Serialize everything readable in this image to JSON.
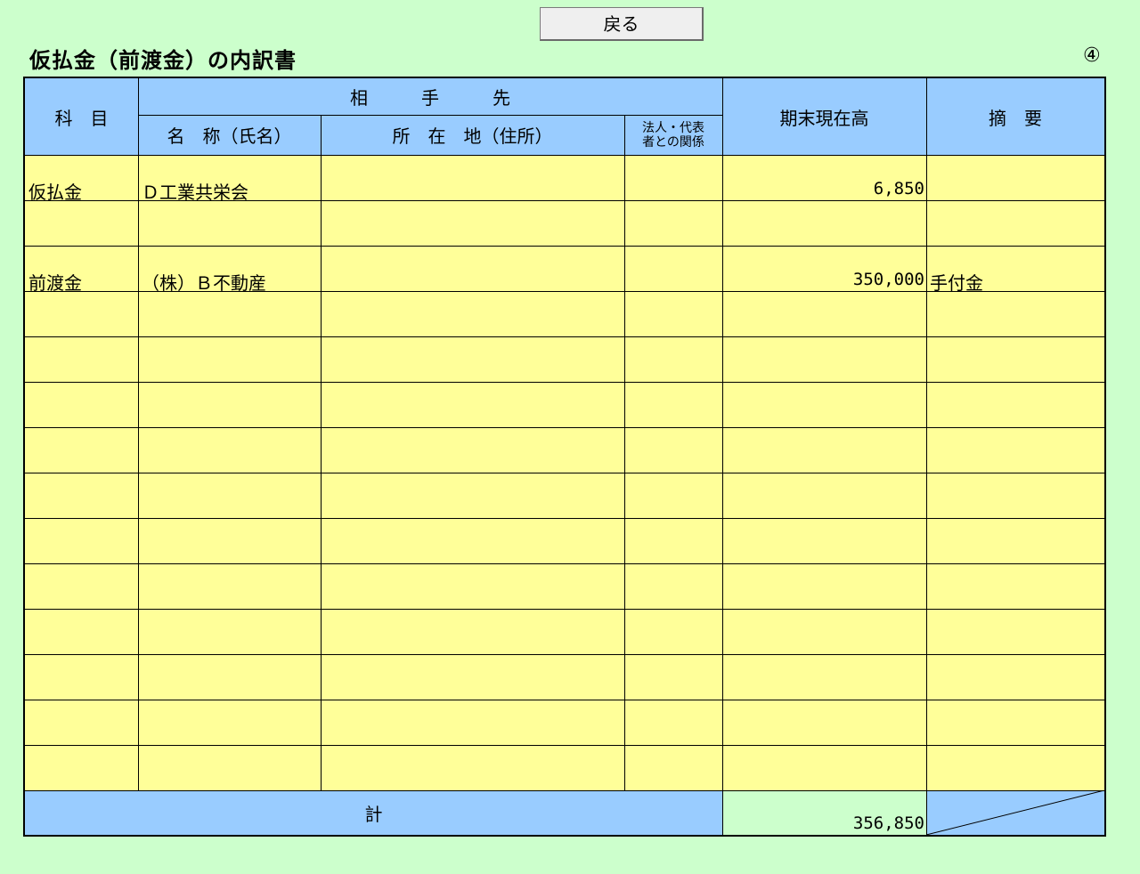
{
  "toolbar": {
    "back_label": "戻る"
  },
  "page": {
    "title": "仮払金（前渡金）の内訳書",
    "page_mark": "④"
  },
  "table": {
    "headers": {
      "subject": "科　目",
      "counterparty": "相　　　手　　　先",
      "name": "名　称（氏名）",
      "address": "所　在　地（住所）",
      "relation_line1": "法人・代表",
      "relation_line2": "者との関係",
      "balance": "期末現在高",
      "remarks": "摘　要"
    },
    "rows": [
      {
        "subject": "仮払金",
        "name": "Ｄ工業共栄会",
        "address": "",
        "relation": "",
        "balance": "6,850",
        "remarks": ""
      },
      {
        "subject": "",
        "name": "",
        "address": "",
        "relation": "",
        "balance": "",
        "remarks": ""
      },
      {
        "subject": "前渡金",
        "name": "（株）Ｂ不動産",
        "address": "",
        "relation": "",
        "balance": "350,000",
        "remarks": "手付金"
      },
      {
        "subject": "",
        "name": "",
        "address": "",
        "relation": "",
        "balance": "",
        "remarks": ""
      },
      {
        "subject": "",
        "name": "",
        "address": "",
        "relation": "",
        "balance": "",
        "remarks": ""
      },
      {
        "subject": "",
        "name": "",
        "address": "",
        "relation": "",
        "balance": "",
        "remarks": ""
      },
      {
        "subject": "",
        "name": "",
        "address": "",
        "relation": "",
        "balance": "",
        "remarks": ""
      },
      {
        "subject": "",
        "name": "",
        "address": "",
        "relation": "",
        "balance": "",
        "remarks": ""
      },
      {
        "subject": "",
        "name": "",
        "address": "",
        "relation": "",
        "balance": "",
        "remarks": ""
      },
      {
        "subject": "",
        "name": "",
        "address": "",
        "relation": "",
        "balance": "",
        "remarks": ""
      },
      {
        "subject": "",
        "name": "",
        "address": "",
        "relation": "",
        "balance": "",
        "remarks": ""
      },
      {
        "subject": "",
        "name": "",
        "address": "",
        "relation": "",
        "balance": "",
        "remarks": ""
      },
      {
        "subject": "",
        "name": "",
        "address": "",
        "relation": "",
        "balance": "",
        "remarks": ""
      },
      {
        "subject": "",
        "name": "",
        "address": "",
        "relation": "",
        "balance": "",
        "remarks": ""
      }
    ],
    "total": {
      "label": "計",
      "value": "356,850"
    }
  },
  "colors": {
    "background": "#ccffcc",
    "header": "#99ccff",
    "input_cell": "#ffff99",
    "total_value_cell": "#ccffcc"
  }
}
